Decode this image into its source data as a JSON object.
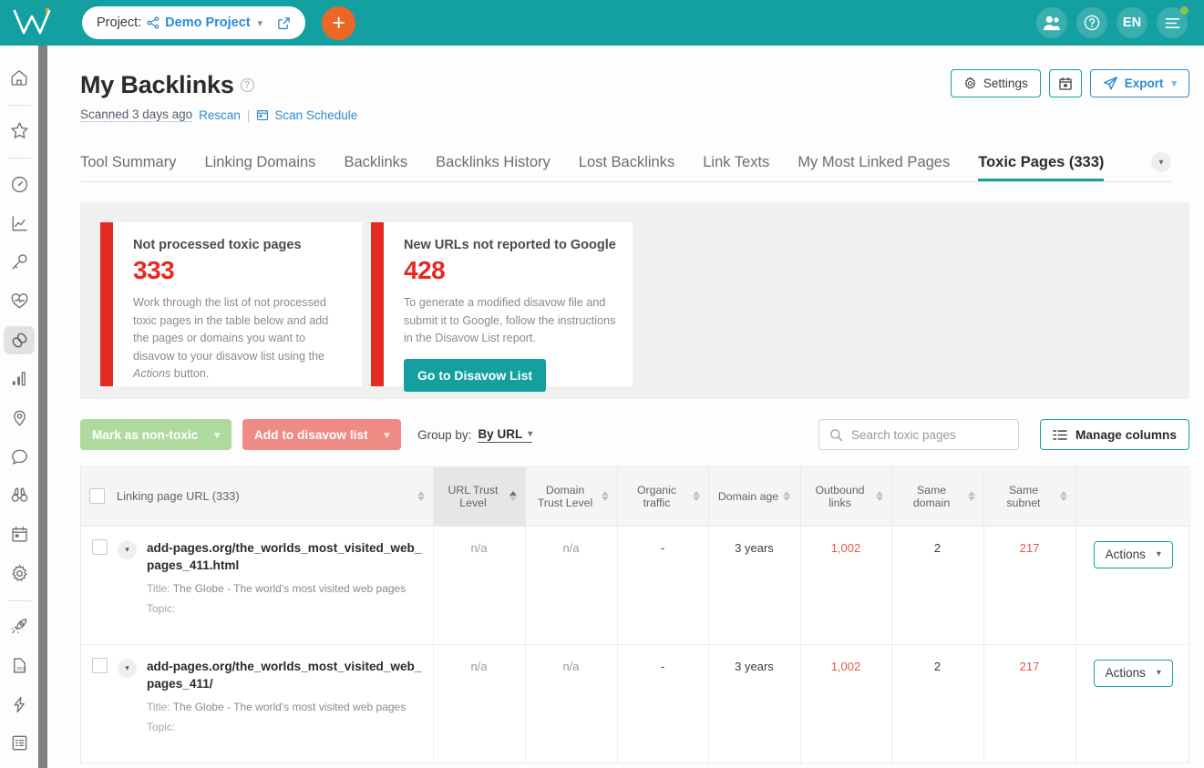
{
  "topbar": {
    "project_label": "Project:",
    "project_name": "Demo Project",
    "lang": "EN",
    "add_label": "+"
  },
  "sidebar": {
    "items": [
      {
        "name": "home-icon",
        "label": "Home"
      },
      {
        "name": "star-icon",
        "label": "Favorites"
      },
      {
        "name": "dashboard-icon",
        "label": "Dashboard"
      },
      {
        "name": "chart-icon",
        "label": "Rank Tracker"
      },
      {
        "name": "key-icon",
        "label": "Keyword Research"
      },
      {
        "name": "site-health-icon",
        "label": "Site Audit"
      },
      {
        "name": "backlinks-icon",
        "label": "Backlinks"
      },
      {
        "name": "bar-chart-icon",
        "label": "Traffic Analytics"
      },
      {
        "name": "location-icon",
        "label": "Local SEO"
      },
      {
        "name": "chat-icon",
        "label": "Social"
      },
      {
        "name": "binoculars-icon",
        "label": "Competitors"
      },
      {
        "name": "calendar-icon",
        "label": "Calendar"
      },
      {
        "name": "gear-icon",
        "label": "Settings"
      },
      {
        "name": "rocket-icon",
        "label": "Boost"
      },
      {
        "name": "pdf-icon",
        "label": "PDF Reports"
      },
      {
        "name": "lightning-icon",
        "label": "Quick Tools"
      },
      {
        "name": "list-icon",
        "label": "Tasks"
      }
    ]
  },
  "page": {
    "title": "My Backlinks",
    "scanned": "Scanned 3 days ago",
    "rescan": "Rescan",
    "separator": "|",
    "scan_schedule": "Scan Schedule",
    "settings_label": "Settings",
    "export_label": "Export"
  },
  "tabs": [
    {
      "label": "Tool Summary",
      "active": false
    },
    {
      "label": "Linking Domains",
      "active": false
    },
    {
      "label": "Backlinks",
      "active": false
    },
    {
      "label": "Backlinks History",
      "active": false
    },
    {
      "label": "Lost Backlinks",
      "active": false
    },
    {
      "label": "Link Texts",
      "active": false
    },
    {
      "label": "My Most Linked Pages",
      "active": false
    },
    {
      "label": "Toxic Pages (333)",
      "active": true
    }
  ],
  "cards": [
    {
      "title": "Not processed toxic pages",
      "value": "333",
      "text_before": "Work through the list of not processed toxic pages in the table below and add the pages or domains you want to disavow to your disavow list using the ",
      "text_em": "Actions",
      "text_after": " button.",
      "accent": "#e52a22"
    },
    {
      "title": "New URLs not reported to Google",
      "value": "428",
      "text_before": "To generate a modified disavow file and submit it to Google, follow the instructions in the Disavow List report.",
      "text_em": "",
      "text_after": "",
      "button": "Go to Disavow List",
      "accent": "#e52a22"
    }
  ],
  "toolbar": {
    "mark_non_toxic": "Mark as non-toxic",
    "add_disavow": "Add to disavow list",
    "group_by_label": "Group by:",
    "group_by_value": "By URL",
    "search_placeholder": "Search toxic pages",
    "manage_columns": "Manage columns"
  },
  "table": {
    "columns": [
      {
        "label": "Linking page URL (333)",
        "sorted": false
      },
      {
        "label": "URL Trust Level",
        "sorted": true
      },
      {
        "label": "Domain Trust Level",
        "sorted": false
      },
      {
        "label": "Organic traffic",
        "sorted": false
      },
      {
        "label": "Domain age",
        "sorted": false
      },
      {
        "label": "Outbound links",
        "sorted": false
      },
      {
        "label": "Same domain",
        "sorted": false
      },
      {
        "label": "Same subnet",
        "sorted": false
      },
      {
        "label": "",
        "sorted": false
      }
    ],
    "rows": [
      {
        "url": "add-pages.org/the_worlds_most_visited_web_pages_411.html",
        "title_label": "Title:",
        "title": "The Globe - The world's most visited web pages",
        "topic_label": "Topic:",
        "topic": "",
        "url_trust": "n/a",
        "domain_trust": "n/a",
        "organic_traffic": "-",
        "domain_age": "3 years",
        "outbound_links": "1,002",
        "same_domain": "2",
        "same_subnet": "217",
        "action": "Actions"
      },
      {
        "url": "add-pages.org/the_worlds_most_visited_web_pages_411/",
        "title_label": "Title:",
        "title": "The Globe - The world's most visited web pages",
        "topic_label": "Topic:",
        "topic": "",
        "url_trust": "n/a",
        "domain_trust": "n/a",
        "organic_traffic": "-",
        "domain_age": "3 years",
        "outbound_links": "1,002",
        "same_domain": "2",
        "same_subnet": "217",
        "action": "Actions"
      }
    ]
  },
  "colors": {
    "brand_teal": "#14a0a0",
    "link_blue": "#2b8bd4",
    "orange": "#ec6726",
    "danger_red": "#e52a22"
  }
}
